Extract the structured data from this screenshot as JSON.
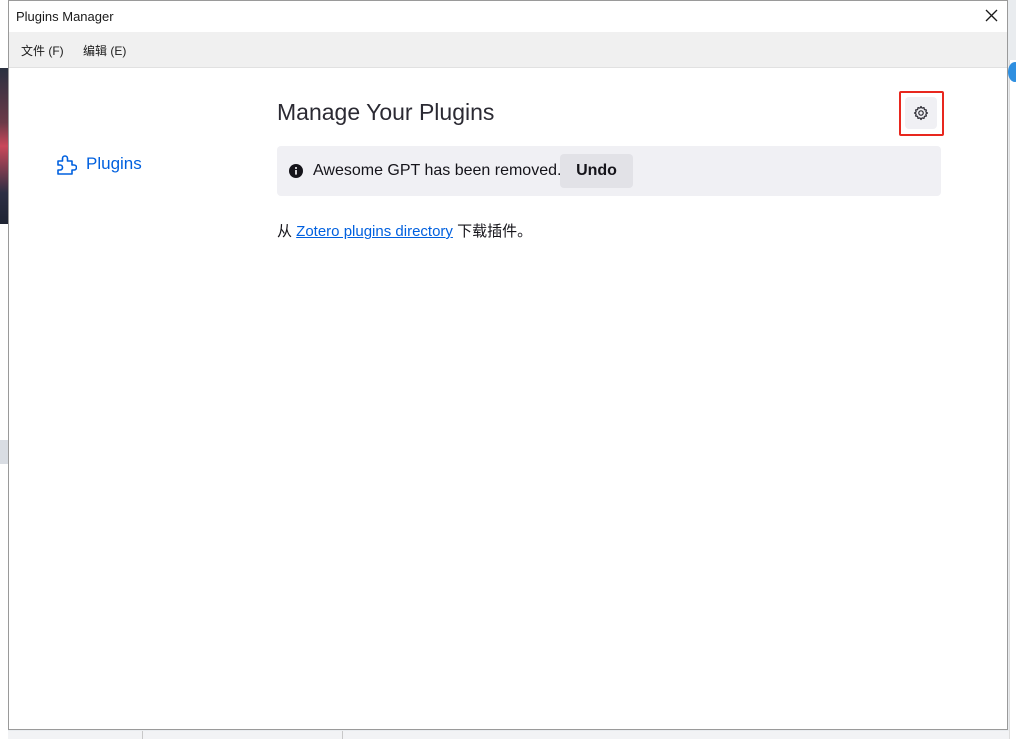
{
  "window": {
    "title": "Plugins Manager",
    "close_glyph": "close-icon"
  },
  "menubar": {
    "file_label": "文件 (F)",
    "edit_label": "编辑 (E)"
  },
  "sidebar": {
    "items": [
      {
        "label": "Plugins",
        "icon": "puzzle-piece-icon",
        "selected": true
      }
    ]
  },
  "main": {
    "title": "Manage Your Plugins",
    "settings_icon": "gear-icon",
    "notice": {
      "icon": "info-icon",
      "text": "Awesome GPT has been removed.",
      "undo_label": "Undo"
    },
    "download": {
      "prefix": "从 ",
      "link_text": "Zotero plugins directory",
      "suffix": " 下载插件。"
    }
  },
  "colors": {
    "accent": "#0060df",
    "highlight": "#e8271e",
    "notice_bg": "#f0f0f4"
  }
}
